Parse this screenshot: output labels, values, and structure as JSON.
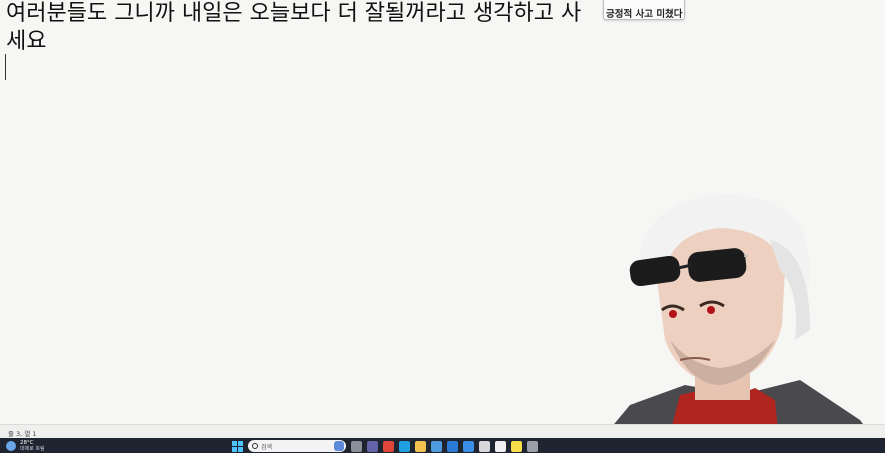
{
  "editor": {
    "text": "여러분들도 그니까 내일은 오늘보다 더 잘될꺼라고 생각하고 사세요"
  },
  "overlay": {
    "title": "",
    "caption": "긍정적 사고 미쳤다"
  },
  "status_bar": {
    "position": "줄 3, 열 1"
  },
  "taskbar": {
    "weather_temp": "28°C",
    "weather_cond": "대체로 흐림",
    "search_placeholder": "검색",
    "apps": [
      {
        "name": "task-view-icon",
        "color": "#8a8f99"
      },
      {
        "name": "teams-icon",
        "color": "#6264a7"
      },
      {
        "name": "chrome-icon",
        "color": "#e0463a"
      },
      {
        "name": "edge-icon",
        "color": "#1fa0e0"
      },
      {
        "name": "file-explorer-icon",
        "color": "#f2c14e"
      },
      {
        "name": "calendar-icon",
        "color": "#4f9be0"
      },
      {
        "name": "mail-icon",
        "color": "#2b7bd6"
      },
      {
        "name": "store-icon",
        "color": "#3a8ee6"
      },
      {
        "name": "app-icon",
        "color": "#d8d8d8"
      },
      {
        "name": "capcut-icon",
        "color": "#f0f0f0"
      },
      {
        "name": "kakaotalk-icon",
        "color": "#f7e04b"
      },
      {
        "name": "settings-icon",
        "color": "#9aa0a8"
      }
    ]
  },
  "colors": {
    "background": "#f6f6f4",
    "taskbar": "#1e2430",
    "accent": "#4cc2ff"
  }
}
